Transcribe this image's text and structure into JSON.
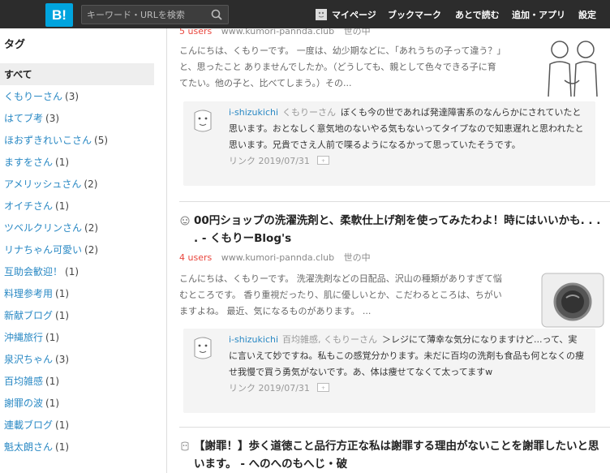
{
  "header": {
    "logo": "B!",
    "search_placeholder": "キーワード・URLを検索",
    "nav": {
      "mypage": "マイページ",
      "bookmark": "ブックマーク",
      "read_later": "あとで読む",
      "add_app": "追加・アプリ",
      "settings": "設定"
    }
  },
  "sidebar": {
    "heading": "タグ",
    "tags": [
      {
        "name": "すべて",
        "count": ""
      },
      {
        "name": "くもりーさん",
        "count": "(3)"
      },
      {
        "name": "はてブ考",
        "count": "(3)"
      },
      {
        "name": "ほおずきれいこさん",
        "count": "(5)"
      },
      {
        "name": "ますをさん",
        "count": "(1)"
      },
      {
        "name": "アメリッシュさん",
        "count": "(2)"
      },
      {
        "name": "オイチさん",
        "count": "(1)"
      },
      {
        "name": "ツベルクリンさん",
        "count": "(2)"
      },
      {
        "name": "リナちゃん可愛い",
        "count": "(2)"
      },
      {
        "name": "互助会歓迎！",
        "count": "(1)"
      },
      {
        "name": "料理参考用",
        "count": "(1)"
      },
      {
        "name": "新献ブログ",
        "count": "(1)"
      },
      {
        "name": "沖縄旅行",
        "count": "(1)"
      },
      {
        "name": "泉沢ちゃん",
        "count": "(3)"
      },
      {
        "name": "百均雑感",
        "count": "(1)"
      },
      {
        "name": "謝罪の波",
        "count": "(1)"
      },
      {
        "name": "連載ブログ",
        "count": "(1)"
      },
      {
        "name": "魁太朗さん",
        "count": "(1)"
      }
    ]
  },
  "entries": [
    {
      "title": "",
      "users": "5 users",
      "domain": "www.kumori-pannda.club",
      "category": "世の中",
      "summary": "こんにちは、くもりーです。 一度は、幼少期などに、「あれうちの子って違う？」と、思ったこと ありませんでしたか。（どうしても、親として色々できる子に育てたい。他の子と、比べてしまう。）その...",
      "comment": {
        "user": "i-shizukichi",
        "tags": "くもりーさん",
        "text": "ぼくも今の世であれば発達障害系のなんらかにされていたと思います。おとなしく意気地のないやる気もないってタイプなので知恵遅れと思われたと思います。兄貴でさえ人前で喋るようになるかって思っていたそうです。",
        "footer": "リンク 2019/07/31"
      }
    },
    {
      "title": "00円ショップの洗濯洗剤と、柔軟仕上げ剤を使ってみたわよ！時にはいいかも. . . . - くもりーBlog's",
      "users": "4 users",
      "domain": "www.kumori-pannda.club",
      "category": "世の中",
      "summary": "こんにちは、くもりーです。 洗濯洗剤などの日配品、沢山の種類がありすぎて悩むところです。 香り重視だったり、肌に優しいとか、こだわるところは、ちがいますよね。 最近、気になるものがあります。 ...",
      "comment": {
        "user": "i-shizukichi",
        "tags": "百均雑感, くもりーさん",
        "text": "＞レジにて薄幸な気分になりますけど...って、実に言いえて妙ですね。私もこの感覚分かります。未だに百均の洗剤も食品も何となくの痩せ我慢で買う勇気がないです。あ、体は痩せてなくて太ってますw",
        "footer": "リンク 2019/07/31"
      }
    },
    {
      "title": "【謝罪！】歩く道徳こと品行方正な私は謝罪する理由がないことを謝罪したいと思います。 - へのへのもへじ・破"
    }
  ],
  "colors": {
    "topbar": "#2c2c2c",
    "logo_bg": "#00a4de",
    "link": "#2a89c4",
    "users": "#e8453c"
  }
}
